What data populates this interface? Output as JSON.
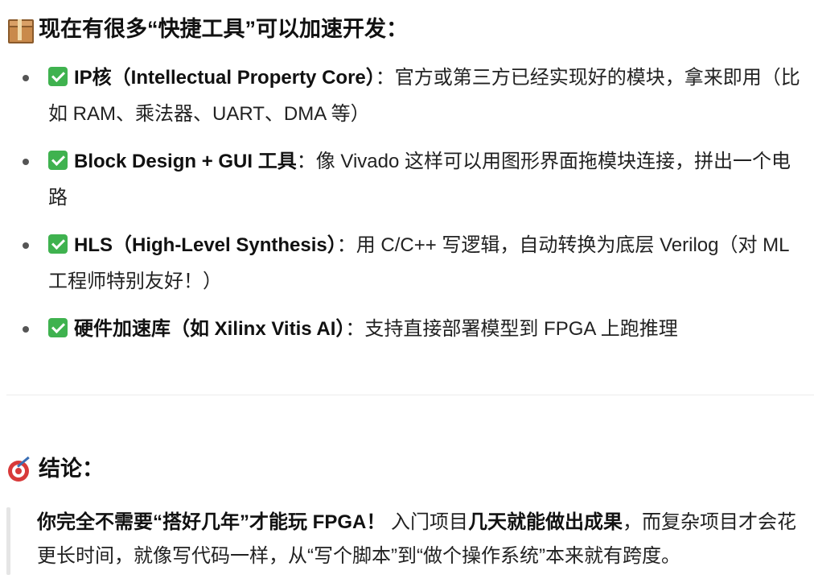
{
  "section1": {
    "icon": "package-icon",
    "title": "现在有很多“快捷工具”可以加速开发："
  },
  "features": [
    {
      "icon": "check-mark-icon",
      "title": "IP核（Intellectual Property Core）",
      "description": "：官方或第三方已经实现好的模块，拿来即用（比如 RAM、乘法器、UART、DMA 等）"
    },
    {
      "icon": "check-mark-icon",
      "title": "Block Design + GUI 工具",
      "description": "：像 Vivado 这样可以用图形界面拖模块连接，拼出一个电路"
    },
    {
      "icon": "check-mark-icon",
      "title": "HLS（High-Level Synthesis）",
      "description": "：用 C/C++ 写逻辑，自动转换为底层 Verilog（对 ML 工程师特别友好！）"
    },
    {
      "icon": "check-mark-icon",
      "title": "硬件加速库（如 Xilinx Vitis AI）",
      "description": "：支持直接部署模型到 FPGA 上跑推理"
    }
  ],
  "section2": {
    "icon": "target-icon",
    "title": "结论："
  },
  "conclusion": {
    "strong1": "你完全不需要“搭好几年”才能玩 FPGA！",
    "text1": " 入门项目",
    "strong2": "几天就能做出成果",
    "text2": "，而复杂项目才会花更长时间，就像写代码一样，从“写个脚本”到“做个操作系统”本来就有跨度。"
  }
}
